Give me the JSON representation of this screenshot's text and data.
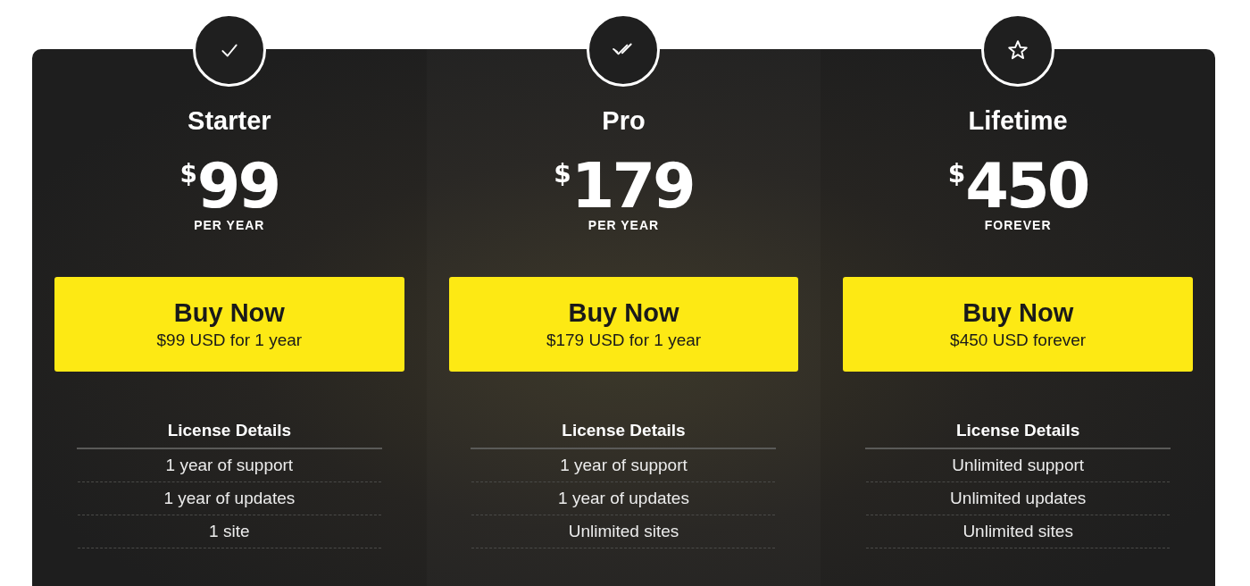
{
  "plans": [
    {
      "kind": "check",
      "name": "Starter",
      "currency": "$",
      "price": "99",
      "period": "PER YEAR",
      "button": {
        "label": "Buy Now",
        "sublabel": "$99 USD for 1 year"
      },
      "details_title": "License Details",
      "details": [
        "1 year of support",
        "1 year of updates",
        "1 site"
      ]
    },
    {
      "kind": "double-check",
      "name": "Pro",
      "currency": "$",
      "price": "179",
      "period": "PER YEAR",
      "button": {
        "label": "Buy Now",
        "sublabel": "$179 USD for 1 year"
      },
      "details_title": "License Details",
      "details": [
        "1 year of support",
        "1 year of updates",
        "Unlimited sites"
      ]
    },
    {
      "kind": "star",
      "name": "Lifetime",
      "currency": "$",
      "price": "450",
      "period": "FOREVER",
      "button": {
        "label": "Buy Now",
        "sublabel": "$450 USD forever"
      },
      "details_title": "License Details",
      "details": [
        "Unlimited support",
        "Unlimited updates",
        "Unlimited sites"
      ]
    }
  ]
}
